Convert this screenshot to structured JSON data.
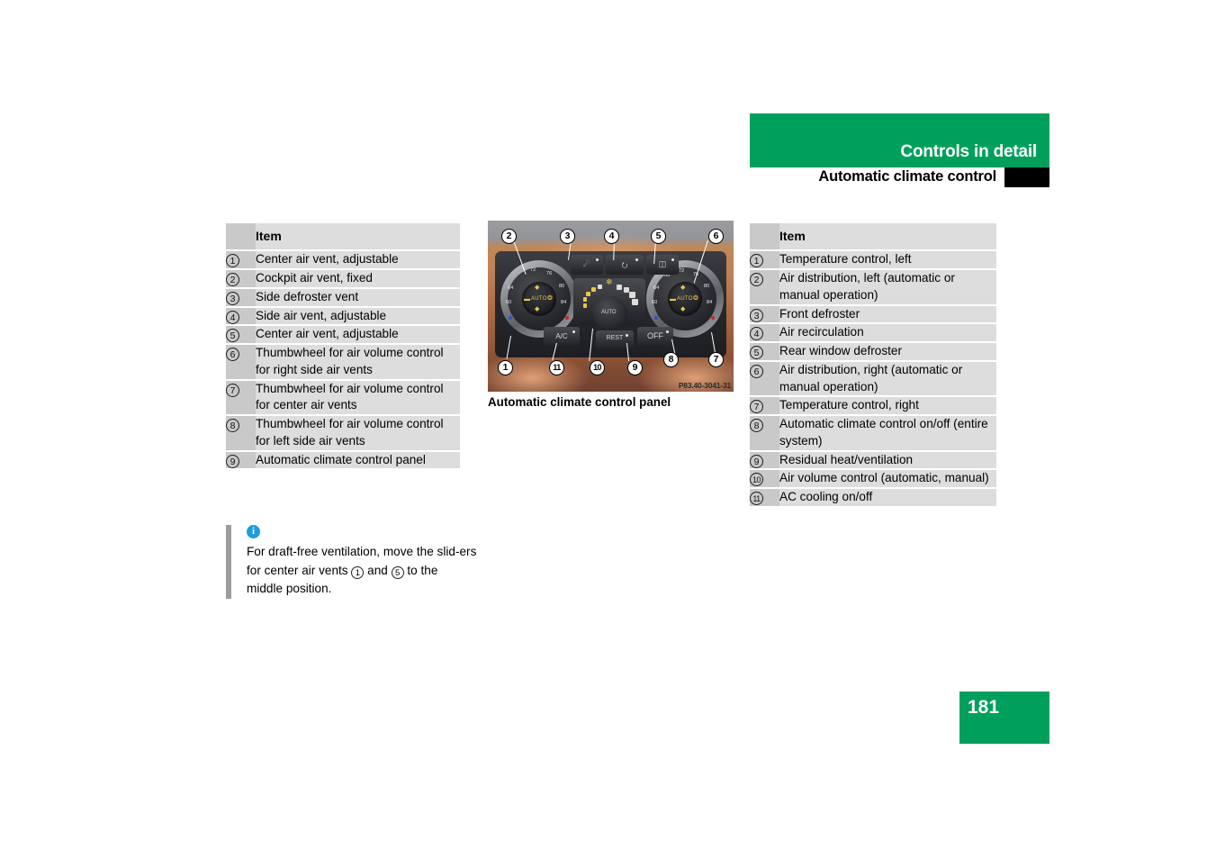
{
  "header": {
    "title": "Controls in detail",
    "subtitle": "Automatic climate control"
  },
  "colors": {
    "brand_green": "#00a05c",
    "thumb_tab_black": "#000000",
    "note_icon_blue": "#1e9ce0",
    "table_number_bg": "#c9c9c9",
    "table_text_bg": "#dddddd"
  },
  "left_table": {
    "header": "Item",
    "rows": [
      {
        "num": "1",
        "text": "Center air vent, adjustable"
      },
      {
        "num": "2",
        "text": "Cockpit air vent, fixed"
      },
      {
        "num": "3",
        "text": "Side defroster vent"
      },
      {
        "num": "4",
        "text": "Side air vent, adjustable"
      },
      {
        "num": "5",
        "text": "Center air vent, adjustable"
      },
      {
        "num": "6",
        "text": "Thumbwheel for air volume control for right side air vents"
      },
      {
        "num": "7",
        "text": "Thumbwheel for air volume control for center air vents"
      },
      {
        "num": "8",
        "text": "Thumbwheel for air volume control for left side air vents"
      },
      {
        "num": "9",
        "text": "Automatic climate control panel"
      }
    ]
  },
  "right_table": {
    "header": "Item",
    "rows": [
      {
        "num": "1",
        "text": "Temperature control, left"
      },
      {
        "num": "2",
        "text": "Air distribution, left (automatic or manual operation)"
      },
      {
        "num": "3",
        "text": "Front defroster"
      },
      {
        "num": "4",
        "text": "Air recirculation"
      },
      {
        "num": "5",
        "text": "Rear window defroster"
      },
      {
        "num": "6",
        "text": "Air distribution, right (automatic or manual operation)"
      },
      {
        "num": "7",
        "text": "Temperature control, right"
      },
      {
        "num": "8",
        "text": "Automatic climate control on/off (entire system)"
      },
      {
        "num": "9",
        "text": "Residual heat/ventilation"
      },
      {
        "num": "10",
        "text": "Air volume control (automatic, manual)"
      },
      {
        "num": "11",
        "text": "AC cooling on/off"
      }
    ]
  },
  "figure": {
    "caption": "Automatic climate control panel",
    "image_code": "P83.40-3041-31",
    "callouts_top": [
      "2",
      "3",
      "4",
      "5",
      "6"
    ],
    "callouts_bottom": [
      "1",
      "11",
      "10",
      "9",
      "8",
      "7"
    ],
    "panel": {
      "left_dial_labels": [
        "60",
        "64",
        "72",
        "76",
        "80",
        "84"
      ],
      "right_dial_labels": [
        "60",
        "64",
        "68",
        "72",
        "76",
        "80",
        "84"
      ],
      "dial_center_text": "AUTO",
      "blower_knob_text": "AUTO",
      "buttons": [
        {
          "label": "A/C",
          "name": "ac-button"
        },
        {
          "label": "REST",
          "name": "rest-button"
        },
        {
          "label": "OFF",
          "name": "off-button"
        }
      ],
      "top_button_icons": [
        "front-defroster-icon",
        "air-recirculation-icon",
        "rear-defroster-icon"
      ],
      "snowflake_icon": "snowflake-icon"
    }
  },
  "note": {
    "icon": "info-icon",
    "text_part1": "For draft-free ventilation, move the slid-ers for center air vents ",
    "ref1": "1",
    "text_part2": " and ",
    "ref2": "5",
    "text_part3": " to the middle position."
  },
  "page": {
    "number": "181"
  }
}
